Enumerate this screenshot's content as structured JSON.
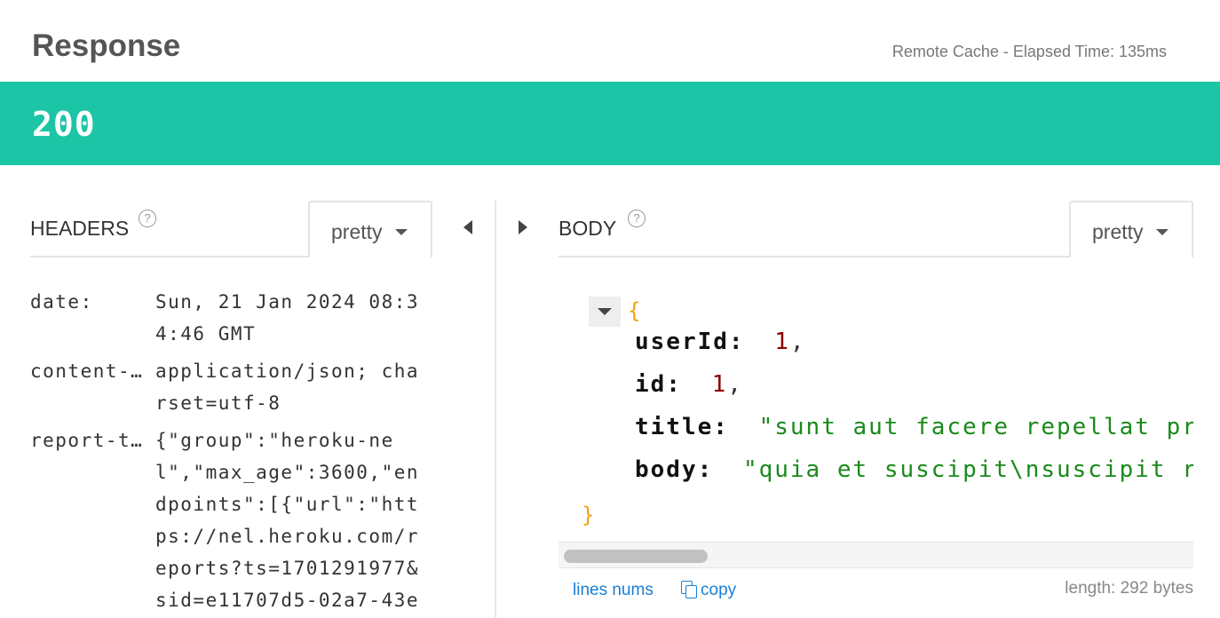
{
  "header": {
    "title": "Response",
    "meta": "Remote Cache -  Elapsed Time: 135ms"
  },
  "status": {
    "code": "200",
    "color": "#1bc5a5"
  },
  "headers_pane": {
    "label": "HEADERS",
    "help": "?",
    "format": "pretty",
    "rows": [
      {
        "key": "date:",
        "value": "Sun, 21 Jan 2024 08:34:46 GMT"
      },
      {
        "key": "content-…",
        "value": "application/json; charset=utf-8"
      },
      {
        "key": "report-t…",
        "value": "{\"group\":\"heroku-nel\",\"max_age\":3600,\"endpoints\":[{\"url\":\"https://nel.heroku.com/reports?ts=1701291977&sid=e11707d5-02a7-43e"
      }
    ]
  },
  "body_pane": {
    "label": "BODY",
    "help": "?",
    "format": "pretty",
    "json": {
      "open": "{",
      "close": "}",
      "lines": [
        {
          "key": "userId:",
          "value": "1",
          "type": "number",
          "trail": ","
        },
        {
          "key": "id:",
          "value": "1",
          "type": "number",
          "trail": ","
        },
        {
          "key": "title:",
          "value": "\"sunt aut facere repellat prov",
          "type": "string",
          "trail": ""
        },
        {
          "key": "body:",
          "value": "\"quia et suscipit\\nsuscipit rec",
          "type": "string",
          "trail": ""
        }
      ]
    },
    "footer": {
      "lines_nums": "lines nums",
      "copy": "copy",
      "length": "length: 292 bytes"
    }
  },
  "icons": {
    "help": "question-circle-icon",
    "collapse": "caret-down-icon",
    "pane_left": "triangle-left-icon",
    "pane_right": "triangle-right-icon",
    "copy": "copy-icon"
  }
}
